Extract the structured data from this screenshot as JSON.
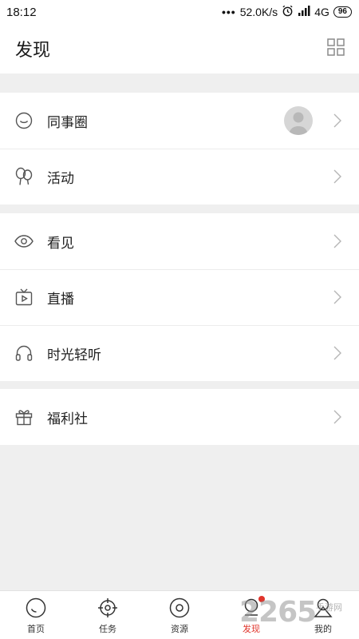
{
  "status_bar": {
    "time": "18:12",
    "dots": "•••",
    "speed": "52.0K/s",
    "network": "4G",
    "battery": "96"
  },
  "header": {
    "title": "发现",
    "grid_icon": "grid-icon"
  },
  "sections": [
    {
      "items": [
        {
          "label": "同事圈",
          "icon": "chat-bubble-icon"
        },
        {
          "label": "活动",
          "icon": "balloons-icon"
        }
      ]
    },
    {
      "items": [
        {
          "label": "看见",
          "icon": "eye-icon"
        },
        {
          "label": "直播",
          "icon": "tv-play-icon"
        },
        {
          "label": "时光轻听",
          "icon": "headphones-icon"
        }
      ]
    },
    {
      "items": [
        {
          "label": "福利社",
          "icon": "gift-icon"
        }
      ]
    }
  ],
  "tabbar": {
    "active": "发现",
    "accent": "#e0342b",
    "items": [
      {
        "label": "首页",
        "icon": "home-icon"
      },
      {
        "label": "任务",
        "icon": "target-icon"
      },
      {
        "label": "资源",
        "icon": "disc-icon"
      },
      {
        "label": "发现",
        "icon": "discover-icon"
      },
      {
        "label": "我的",
        "icon": "profile-icon"
      }
    ]
  },
  "watermark": {
    "big": "2265",
    "small": "手游网"
  }
}
